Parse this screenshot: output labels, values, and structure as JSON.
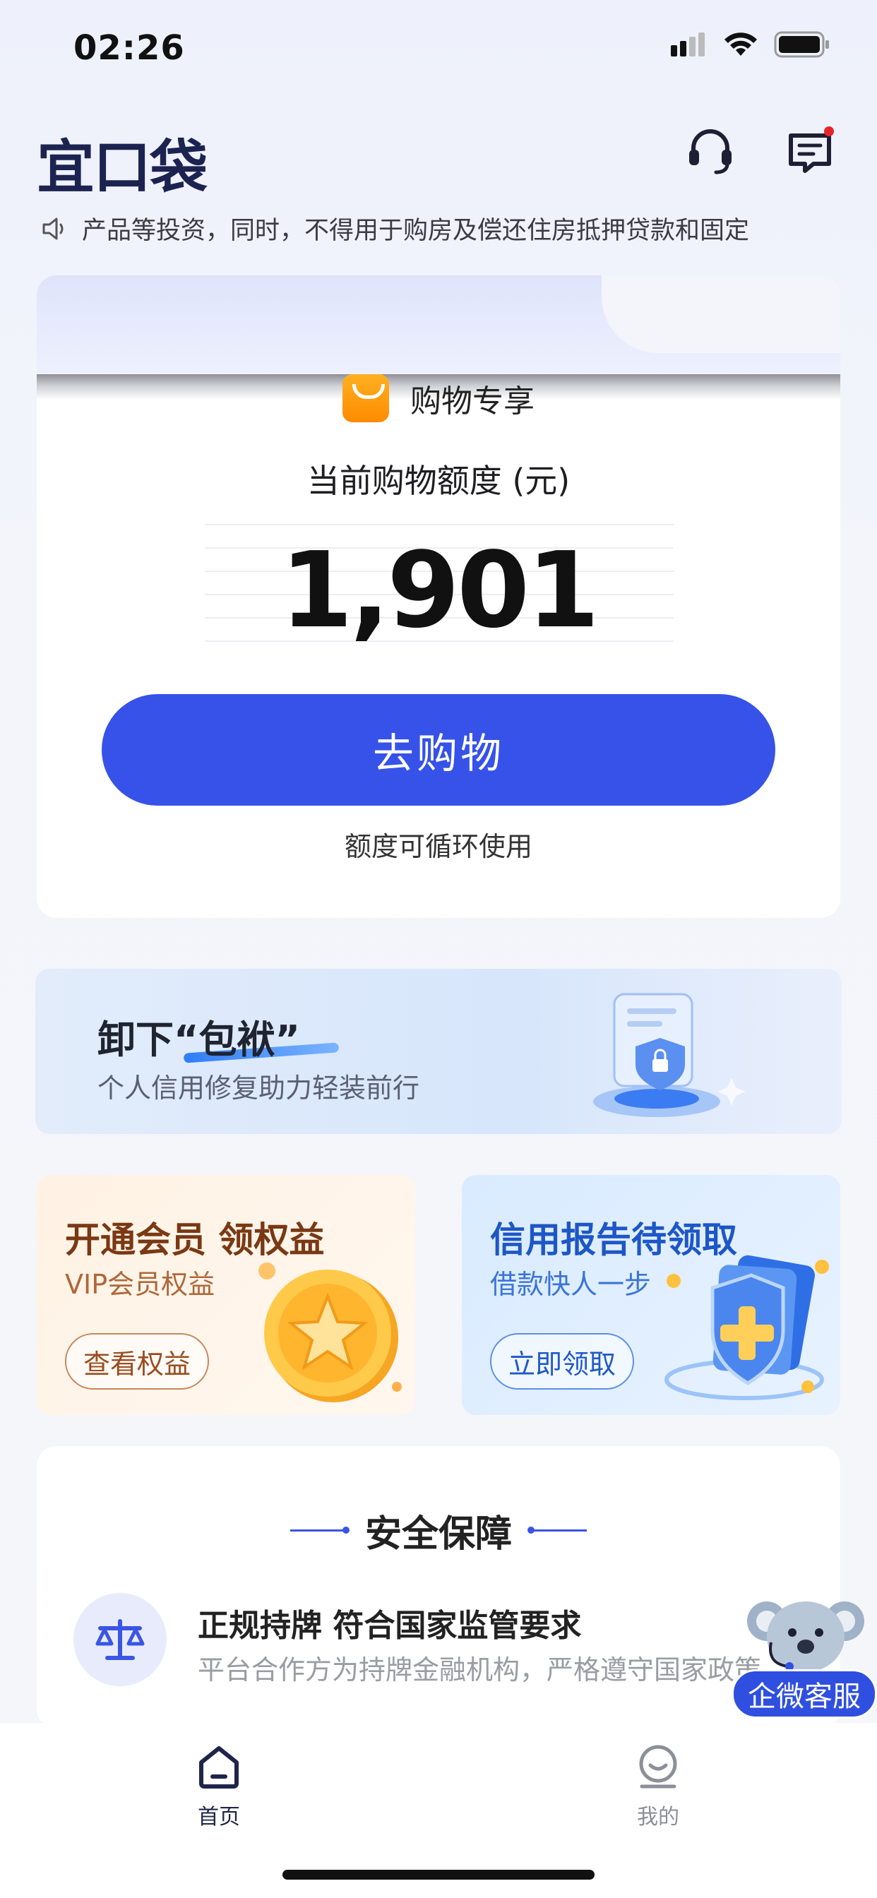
{
  "status_bar": {
    "time": "02:26"
  },
  "header": {
    "logo_text": "宜口袋",
    "icons": [
      "headset-icon",
      "message-icon"
    ]
  },
  "notice": {
    "icon": "speaker-icon",
    "text": "产品等投资，同时，不得用于购房及偿还住房抵押贷款和固定"
  },
  "shopping_card": {
    "title": "购物专享",
    "quota_label": "当前购物额度 (元)",
    "amount": "1,901",
    "button_label": "去购物",
    "note": "额度可循环使用"
  },
  "banner": {
    "title": "卸下“包袱”",
    "subtitle": "个人信用修复助力轻装前行"
  },
  "promos": [
    {
      "title": "开通会员 领权益",
      "subtitle": "VIP会员权益",
      "button": "查看权益"
    },
    {
      "title": "信用报告待领取",
      "subtitle": "借款快人一步",
      "button": "立即领取"
    }
  ],
  "security": {
    "title": "安全保障",
    "item_title": "正规持牌 符合国家监管要求",
    "item_desc": "平台合作方为持牌金融机构，严格遵守国家政策"
  },
  "float_service": {
    "label": "企微客服"
  },
  "tabbar": {
    "home": "首页",
    "mine": "我的"
  },
  "colors": {
    "primary": "#3652e8",
    "logo": "#1d2350",
    "notification_dot": "#e5252a"
  }
}
